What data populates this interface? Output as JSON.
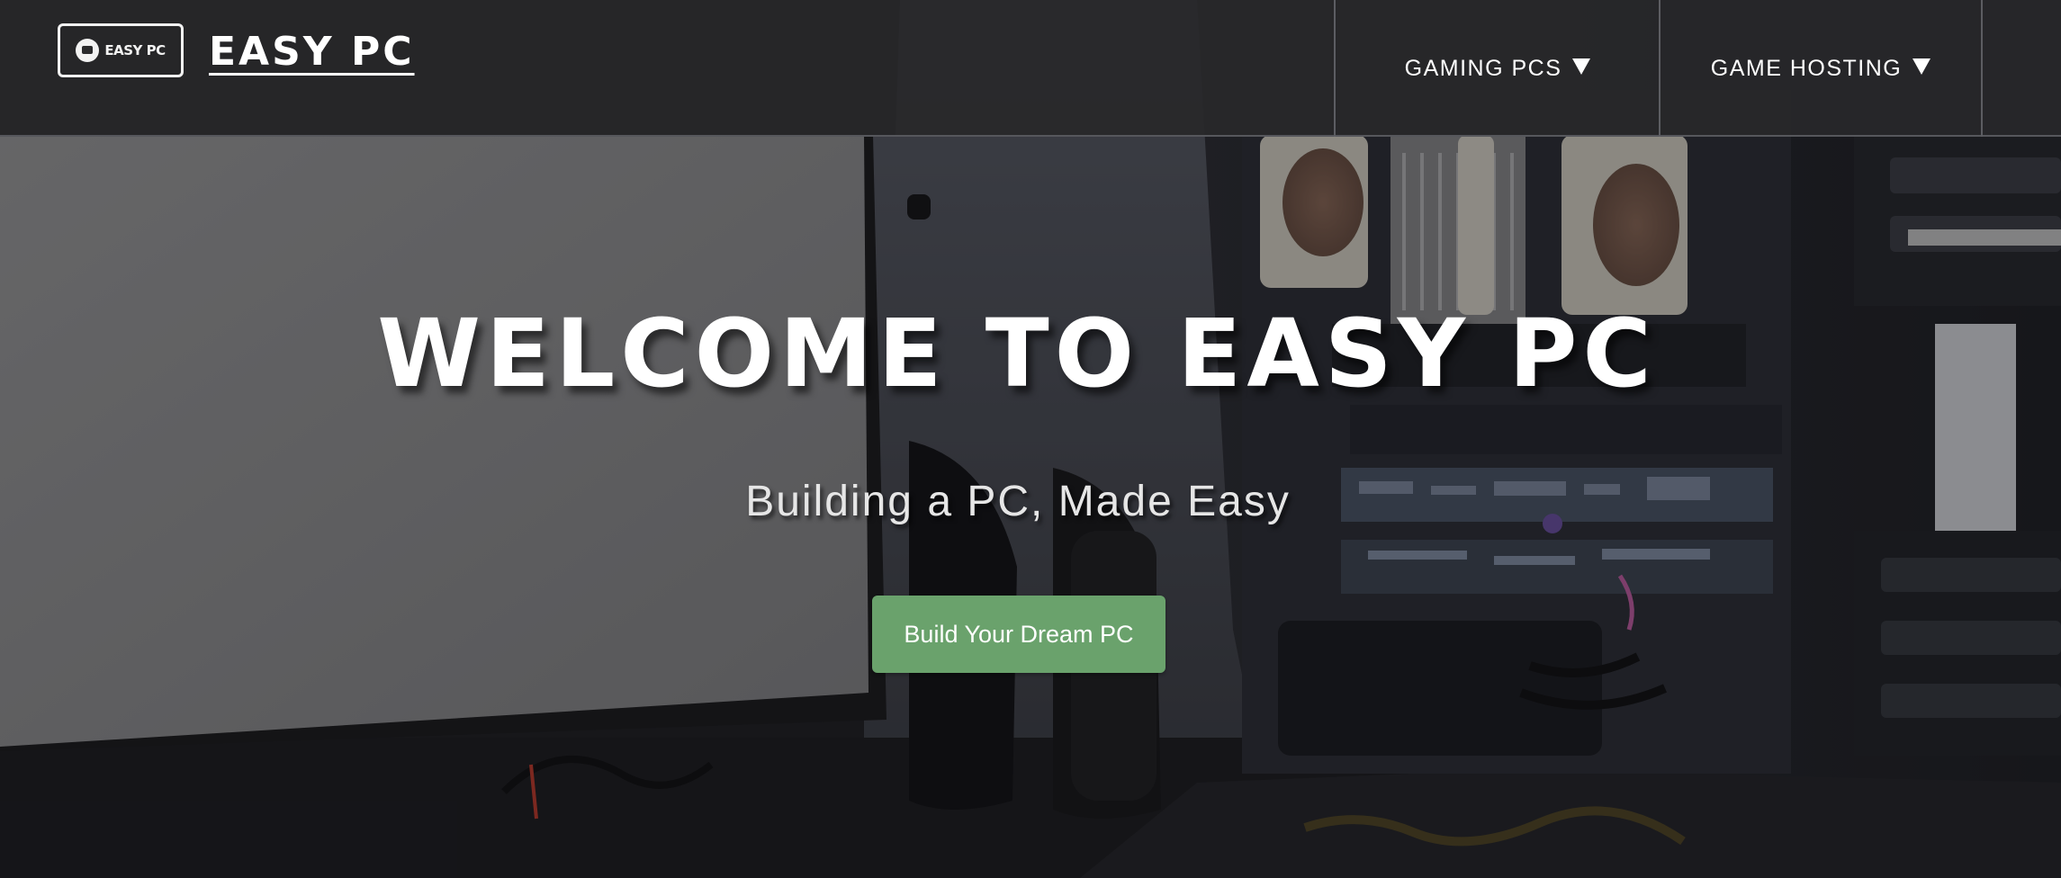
{
  "brand": {
    "logo_text": "EASY PC",
    "name": "EASY PC"
  },
  "nav": {
    "items": [
      {
        "label": "GAMING PCS",
        "icon": "caret-down-icon"
      },
      {
        "label": "GAME HOSTING",
        "icon": "caret-down-icon"
      }
    ]
  },
  "hero": {
    "title": "WELCOME TO EASY PC",
    "subtitle": "Building a PC, Made Easy",
    "cta_label": "Build Your Dream PC"
  },
  "colors": {
    "navbar": "#2a2a2c",
    "cta": "#6aa26c",
    "text": "#ffffff"
  }
}
